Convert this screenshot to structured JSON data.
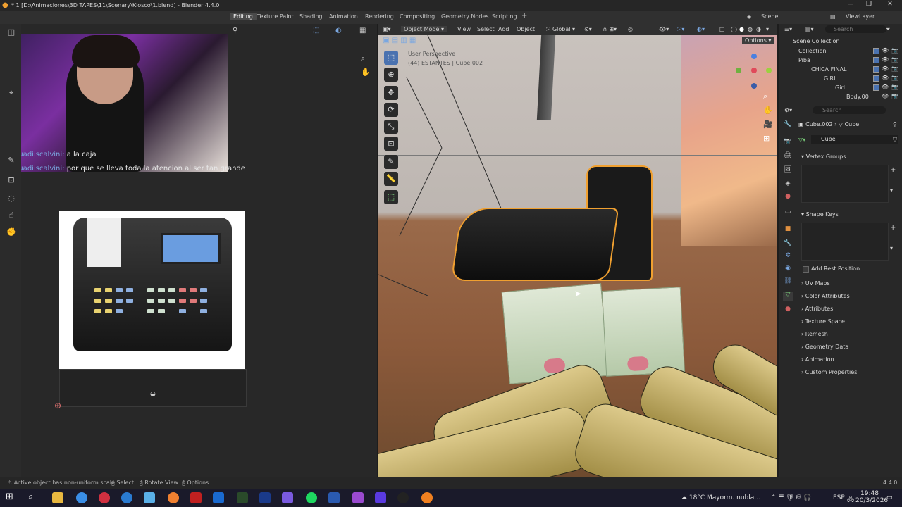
{
  "window": {
    "title": "* 1 [D:\\Animaciones\\3D TAPES\\11\\Scenary\\Kiosco\\1.blend] - Blender 4.4.0"
  },
  "workspaces": [
    "Editing",
    "Texture Paint",
    "Shading",
    "Animation",
    "Rendering",
    "Compositing",
    "Geometry Nodes",
    "Scripting"
  ],
  "header_right": {
    "scene": "Scene",
    "view_layer": "ViewLayer"
  },
  "chat": [
    {
      "user": "guadiiscalvini:",
      "message": "a la caja"
    },
    {
      "user": "guadiiscalvini:",
      "message": "por que se lleva toda la atencion al ser tan grande"
    }
  ],
  "viewport": {
    "mode": "Object Mode",
    "menus": [
      "View",
      "Select",
      "Add",
      "Object"
    ],
    "orientation": "Global",
    "options": "Options",
    "perspective": "User Perspective",
    "collection_info": "(44) ESTANTES | Cube.002"
  },
  "outliner": {
    "search_placeholder": "Search",
    "items": [
      "Scene Collection",
      "Collection",
      "Piba",
      "CHICA FINAL",
      "GIRL",
      "Girl",
      "Body.00"
    ]
  },
  "properties": {
    "search_placeholder": "Search",
    "object": "Cube.002",
    "mesh": "Cube",
    "data_name": "Cube",
    "sections": {
      "vertex_groups": "Vertex Groups",
      "shape_keys": "Shape Keys",
      "add_rest_position": "Add Rest Position",
      "uv_maps": "UV Maps",
      "color_attributes": "Color Attributes",
      "attributes": "Attributes",
      "texture_space": "Texture Space",
      "remesh": "Remesh",
      "geometry_data": "Geometry Data",
      "animation": "Animation",
      "custom_properties": "Custom Properties"
    }
  },
  "statusbar": {
    "message": "Active object has non-uniform scale",
    "select": "Select",
    "rotate": "Rotate View",
    "options": "Options",
    "version": "4.4.0"
  },
  "taskbar": {
    "weather": "18°C  Mayorm. nubla...",
    "lang": "ESP",
    "time": "19:48",
    "date": "20/3/2026"
  },
  "colors": {
    "selection_outline": "#f0a030",
    "active_workspace": "#4a4a4a",
    "accent_blue": "#4a72b0"
  }
}
